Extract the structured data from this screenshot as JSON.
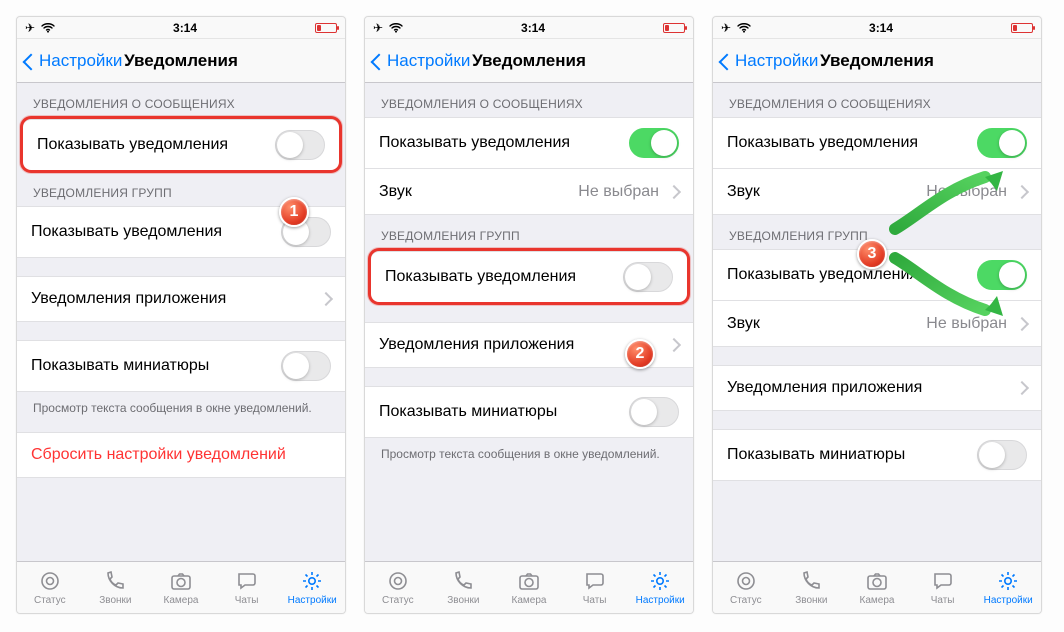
{
  "status": {
    "time": "3:14"
  },
  "nav": {
    "back": "Настройки",
    "title": "Уведомления"
  },
  "sections": {
    "messages_header": "УВЕДОМЛЕНИЯ О СООБЩЕНИЯХ",
    "groups_header": "УВЕДОМЛЕНИЯ ГРУПП"
  },
  "cells": {
    "show_notifications": "Показывать уведомления",
    "sound": "Звук",
    "sound_value": "Не выбран",
    "app_notifications": "Уведомления приложения",
    "show_thumbnails": "Показывать миниатюры",
    "thumbnails_footnote": "Просмотр текста сообщения в окне уведомлений.",
    "reset": "Сбросить настройки уведомлений"
  },
  "tabs": {
    "status": "Статус",
    "calls": "Звонки",
    "camera": "Камера",
    "chats": "Чаты",
    "settings": "Настройки"
  },
  "badges": {
    "one": "1",
    "two": "2",
    "three": "3"
  }
}
